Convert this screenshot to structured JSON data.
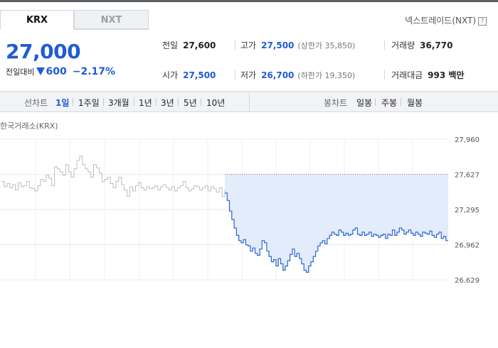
{
  "tabs": [
    "KRX",
    "NXT"
  ],
  "nxt_link": "넥스트레이드(NXT)",
  "price": {
    "current": "27,000",
    "change_label": "전일대비",
    "change_amount": "600",
    "change_pct": "−2.17%",
    "direction": "down"
  },
  "stats": {
    "prev_close": {
      "label": "전일",
      "value": "27,600"
    },
    "high": {
      "label": "고가",
      "value": "27,500",
      "sub": "(상한가 35,850)"
    },
    "volume": {
      "label": "거래량",
      "value": "36,770"
    },
    "open": {
      "label": "시가",
      "value": "27,500"
    },
    "low": {
      "label": "저가",
      "value": "26,700",
      "sub": "(하한가 19,350)"
    },
    "amount": {
      "label": "거래대금",
      "value": "993 백만"
    }
  },
  "periods": {
    "line_label": "선차트",
    "line_items": [
      "1일",
      "1주일",
      "3개월",
      "1년",
      "3년",
      "5년",
      "10년"
    ],
    "active": "1일",
    "candle_label": "봉차트",
    "candle_items": [
      "일봉",
      "주봉",
      "월봉"
    ]
  },
  "chart_title": "한국거래소(KRX)",
  "colors": {
    "accent": "#1f5bd8",
    "line": "#2a64d6",
    "fill": "#e3ecfa",
    "prev_line": "#bdbdbd"
  },
  "chart_data": {
    "type": "line",
    "ylim": [
      26629,
      27960
    ],
    "ytick_labels": [
      "27,960",
      "27,627",
      "27,295",
      "26,962",
      "26,629"
    ],
    "yticks": [
      27960,
      27627,
      27295,
      26962,
      26629
    ],
    "reference_value": 27627,
    "prev_day_series": [
      27560,
      27510,
      27540,
      27500,
      27530,
      27480,
      27550,
      27510,
      27520,
      27560,
      27500,
      27490,
      27470,
      27520,
      27580,
      27560,
      27620,
      27590,
      27520,
      27700,
      27680,
      27650,
      27620,
      27720,
      27650,
      27600,
      27680,
      27760,
      27800,
      27720,
      27680,
      27650,
      27600,
      27720,
      27690,
      27640,
      27560,
      27580,
      27600,
      27540,
      27500,
      27560,
      27600,
      27530,
      27480,
      27420,
      27510,
      27470,
      27520,
      27550,
      27500,
      27480,
      27510,
      27490,
      27500,
      27520,
      27480,
      27510,
      27530,
      27500,
      27480,
      27510,
      27470,
      27500,
      27520,
      27560,
      27500,
      27470,
      27490,
      27520,
      27510,
      27480,
      27500,
      27520,
      27470,
      27510,
      27490,
      27460,
      27500,
      27420,
      27480
    ],
    "today_series": [
      27450,
      27380,
      27280,
      27200,
      27120,
      27050,
      27000,
      26980,
      27010,
      26960,
      26950,
      26900,
      26930,
      26880,
      26860,
      26920,
      27000,
      26980,
      26900,
      26850,
      26800,
      26820,
      26760,
      26830,
      26780,
      26720,
      26760,
      26810,
      26870,
      26920,
      26850,
      26880,
      26830,
      26780,
      26720,
      26700,
      26760,
      26800,
      26850,
      26900,
      26950,
      26980,
      27000,
      26970,
      27020,
      27050,
      27080,
      27060,
      27050,
      27100,
      27080,
      27050,
      27070,
      27050,
      27060,
      27100,
      27120,
      27060,
      27050,
      27080,
      27050,
      27060,
      27080,
      27040,
      27060,
      27050,
      27030,
      27050,
      27060,
      27020,
      27060,
      27050,
      27100,
      27050,
      27080,
      27120,
      27100,
      27060,
      27080,
      27100,
      27070,
      27050,
      27080,
      27060,
      27040,
      27080,
      27070,
      27060,
      27090,
      27050,
      27030,
      27060,
      27080,
      27020,
      27040,
      27000,
      27000
    ]
  }
}
